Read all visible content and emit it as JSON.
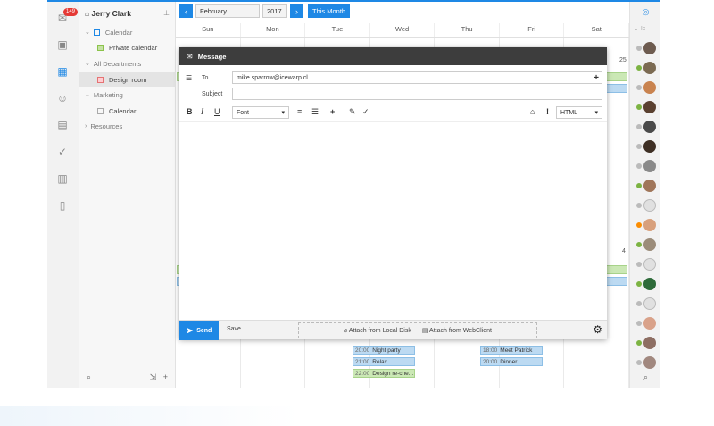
{
  "rail": {
    "mail_badge": "149"
  },
  "tree": {
    "user_name": "Jerry Clark",
    "items": [
      {
        "label": "Calendar",
        "kind": "group",
        "checkbox_color": "#1e88e5"
      },
      {
        "label": "Private calendar",
        "kind": "item",
        "checkbox_color": "#8bc34a"
      },
      {
        "label": "All Departments",
        "kind": "group"
      },
      {
        "label": "Design room",
        "kind": "item",
        "checkbox_color": "#e57373",
        "selected": true
      },
      {
        "label": "Marketing",
        "kind": "group"
      },
      {
        "label": "Calendar",
        "kind": "item"
      },
      {
        "label": "Resources",
        "kind": "collapsed-group"
      }
    ]
  },
  "calendar": {
    "month": "February",
    "year": "2017",
    "this_month_label": "This Month",
    "day_headers": [
      "Sun",
      "Mon",
      "Tue",
      "Wed",
      "Thu",
      "Fri",
      "Sat"
    ],
    "day_numbers": {
      "sat_row1": "25",
      "sat_row2": "4"
    },
    "events": [
      {
        "time": "20:00",
        "title": "Night party",
        "color": "blue"
      },
      {
        "time": "21:00",
        "title": "Relax",
        "color": "blue"
      },
      {
        "time": "22:00",
        "title": "Design re-che...",
        "color": "green"
      },
      {
        "time": "18:00",
        "title": "Meet Patrick",
        "color": "blue"
      },
      {
        "time": "20:00",
        "title": "Dinner",
        "color": "blue"
      }
    ]
  },
  "people": {
    "filter_placeholder": "Ic"
  },
  "message": {
    "title": "Message",
    "to_label": "To",
    "to_value": "mike.sparrow@icewarp.cl",
    "subject_label": "Subject",
    "subject_value": "",
    "font_select": "Font",
    "format_select": "HTML",
    "send_label": "Send",
    "save_label": "Save",
    "attach_local": "Attach from Local Disk",
    "attach_webclient": "Attach from WebClient"
  },
  "colors": {
    "accent": "#1e88e5",
    "header": "#3d3d3d"
  }
}
